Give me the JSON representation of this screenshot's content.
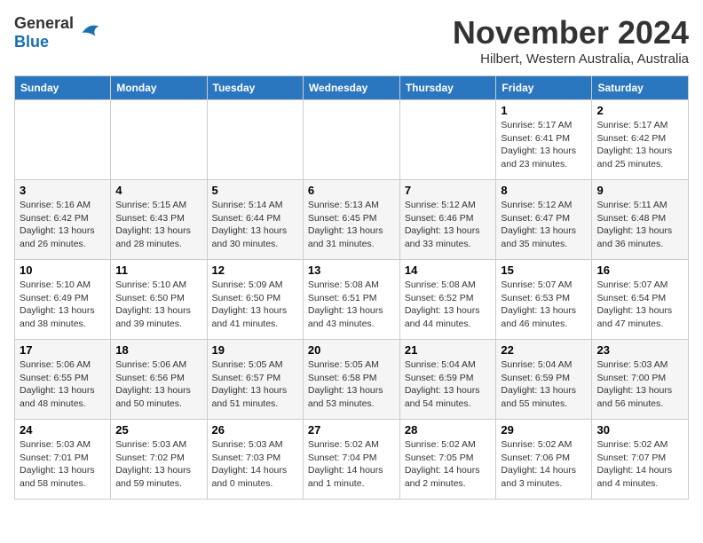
{
  "logo": {
    "general": "General",
    "blue": "Blue"
  },
  "title": {
    "month_year": "November 2024",
    "location": "Hilbert, Western Australia, Australia"
  },
  "weekdays": [
    "Sunday",
    "Monday",
    "Tuesday",
    "Wednesday",
    "Thursday",
    "Friday",
    "Saturday"
  ],
  "weeks": [
    [
      {
        "day": "",
        "info": ""
      },
      {
        "day": "",
        "info": ""
      },
      {
        "day": "",
        "info": ""
      },
      {
        "day": "",
        "info": ""
      },
      {
        "day": "",
        "info": ""
      },
      {
        "day": "1",
        "info": "Sunrise: 5:17 AM\nSunset: 6:41 PM\nDaylight: 13 hours\nand 23 minutes."
      },
      {
        "day": "2",
        "info": "Sunrise: 5:17 AM\nSunset: 6:42 PM\nDaylight: 13 hours\nand 25 minutes."
      }
    ],
    [
      {
        "day": "3",
        "info": "Sunrise: 5:16 AM\nSunset: 6:42 PM\nDaylight: 13 hours\nand 26 minutes."
      },
      {
        "day": "4",
        "info": "Sunrise: 5:15 AM\nSunset: 6:43 PM\nDaylight: 13 hours\nand 28 minutes."
      },
      {
        "day": "5",
        "info": "Sunrise: 5:14 AM\nSunset: 6:44 PM\nDaylight: 13 hours\nand 30 minutes."
      },
      {
        "day": "6",
        "info": "Sunrise: 5:13 AM\nSunset: 6:45 PM\nDaylight: 13 hours\nand 31 minutes."
      },
      {
        "day": "7",
        "info": "Sunrise: 5:12 AM\nSunset: 6:46 PM\nDaylight: 13 hours\nand 33 minutes."
      },
      {
        "day": "8",
        "info": "Sunrise: 5:12 AM\nSunset: 6:47 PM\nDaylight: 13 hours\nand 35 minutes."
      },
      {
        "day": "9",
        "info": "Sunrise: 5:11 AM\nSunset: 6:48 PM\nDaylight: 13 hours\nand 36 minutes."
      }
    ],
    [
      {
        "day": "10",
        "info": "Sunrise: 5:10 AM\nSunset: 6:49 PM\nDaylight: 13 hours\nand 38 minutes."
      },
      {
        "day": "11",
        "info": "Sunrise: 5:10 AM\nSunset: 6:50 PM\nDaylight: 13 hours\nand 39 minutes."
      },
      {
        "day": "12",
        "info": "Sunrise: 5:09 AM\nSunset: 6:50 PM\nDaylight: 13 hours\nand 41 minutes."
      },
      {
        "day": "13",
        "info": "Sunrise: 5:08 AM\nSunset: 6:51 PM\nDaylight: 13 hours\nand 43 minutes."
      },
      {
        "day": "14",
        "info": "Sunrise: 5:08 AM\nSunset: 6:52 PM\nDaylight: 13 hours\nand 44 minutes."
      },
      {
        "day": "15",
        "info": "Sunrise: 5:07 AM\nSunset: 6:53 PM\nDaylight: 13 hours\nand 46 minutes."
      },
      {
        "day": "16",
        "info": "Sunrise: 5:07 AM\nSunset: 6:54 PM\nDaylight: 13 hours\nand 47 minutes."
      }
    ],
    [
      {
        "day": "17",
        "info": "Sunrise: 5:06 AM\nSunset: 6:55 PM\nDaylight: 13 hours\nand 48 minutes."
      },
      {
        "day": "18",
        "info": "Sunrise: 5:06 AM\nSunset: 6:56 PM\nDaylight: 13 hours\nand 50 minutes."
      },
      {
        "day": "19",
        "info": "Sunrise: 5:05 AM\nSunset: 6:57 PM\nDaylight: 13 hours\nand 51 minutes."
      },
      {
        "day": "20",
        "info": "Sunrise: 5:05 AM\nSunset: 6:58 PM\nDaylight: 13 hours\nand 53 minutes."
      },
      {
        "day": "21",
        "info": "Sunrise: 5:04 AM\nSunset: 6:59 PM\nDaylight: 13 hours\nand 54 minutes."
      },
      {
        "day": "22",
        "info": "Sunrise: 5:04 AM\nSunset: 6:59 PM\nDaylight: 13 hours\nand 55 minutes."
      },
      {
        "day": "23",
        "info": "Sunrise: 5:03 AM\nSunset: 7:00 PM\nDaylight: 13 hours\nand 56 minutes."
      }
    ],
    [
      {
        "day": "24",
        "info": "Sunrise: 5:03 AM\nSunset: 7:01 PM\nDaylight: 13 hours\nand 58 minutes."
      },
      {
        "day": "25",
        "info": "Sunrise: 5:03 AM\nSunset: 7:02 PM\nDaylight: 13 hours\nand 59 minutes."
      },
      {
        "day": "26",
        "info": "Sunrise: 5:03 AM\nSunset: 7:03 PM\nDaylight: 14 hours\nand 0 minutes."
      },
      {
        "day": "27",
        "info": "Sunrise: 5:02 AM\nSunset: 7:04 PM\nDaylight: 14 hours\nand 1 minute."
      },
      {
        "day": "28",
        "info": "Sunrise: 5:02 AM\nSunset: 7:05 PM\nDaylight: 14 hours\nand 2 minutes."
      },
      {
        "day": "29",
        "info": "Sunrise: 5:02 AM\nSunset: 7:06 PM\nDaylight: 14 hours\nand 3 minutes."
      },
      {
        "day": "30",
        "info": "Sunrise: 5:02 AM\nSunset: 7:07 PM\nDaylight: 14 hours\nand 4 minutes."
      }
    ]
  ]
}
